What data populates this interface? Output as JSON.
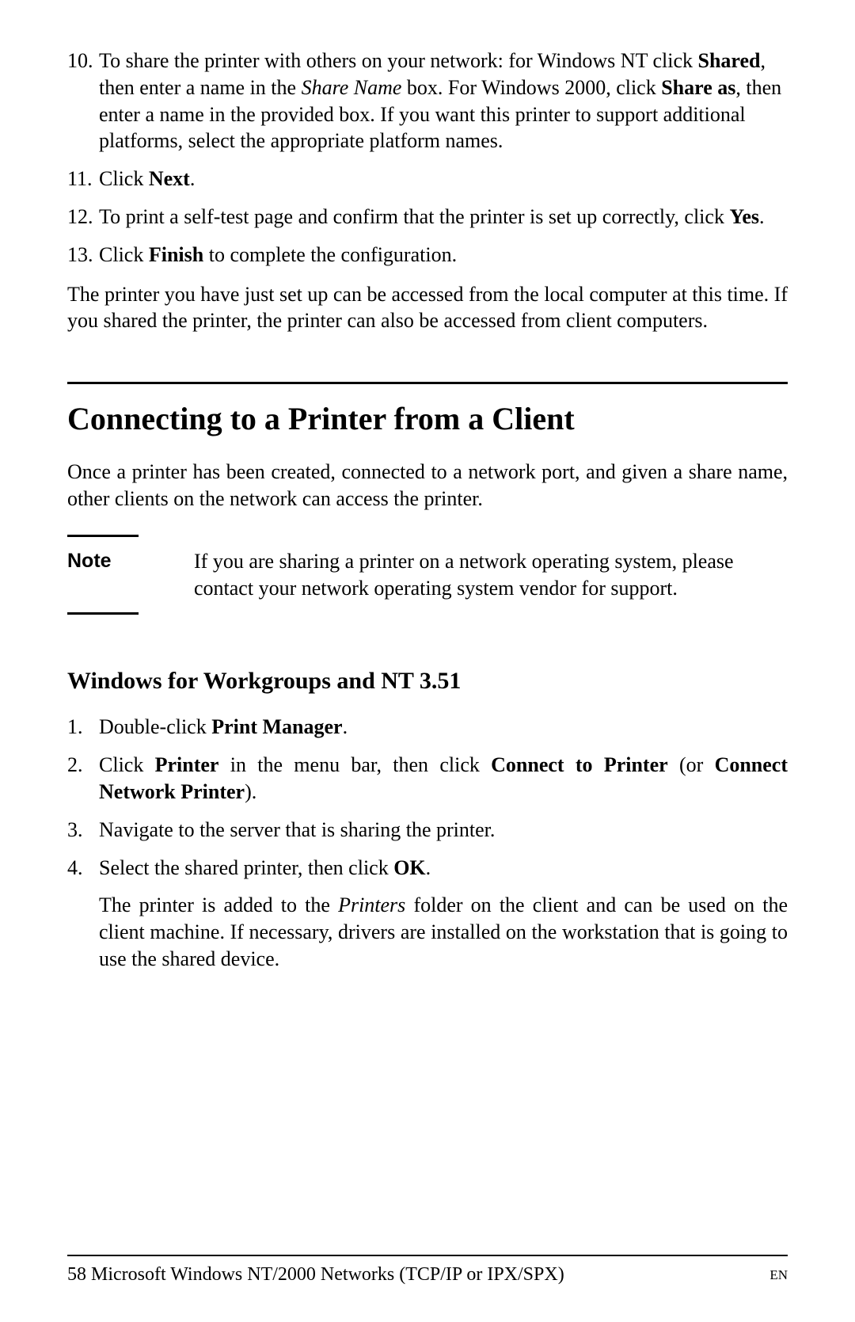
{
  "steps": {
    "s10_a": "To share the printer with others on your network: for Windows NT click ",
    "s10_b": "Shared",
    "s10_c": ", then enter a name in the ",
    "s10_d": "Share Name",
    "s10_e": " box. For Windows 2000, click ",
    "s10_f": "Share as",
    "s10_g": ", then enter a name in the provided box. If you want this printer to support additional platforms, select the appropriate platform names.",
    "s11_a": "Click ",
    "s11_b": "Next",
    "s11_c": ".",
    "s12_a": "To print a self-test page and confirm that the printer is set up correctly, click ",
    "s12_b": "Yes",
    "s12_c": ".",
    "s13_a": "Click ",
    "s13_b": "Finish",
    "s13_c": " to complete the configuration."
  },
  "para1": "The printer you have just set up can be accessed from the local computer at this time. If you shared the printer, the printer can also be accessed from client computers.",
  "heading1": "Connecting to a Printer from a Client",
  "para2": "Once a printer has been created, connected to a network port, and given a share name, other clients on the network can access the printer.",
  "note_label": "Note",
  "note_text": "If you are sharing a printer on a network operating system, please contact your network operating system vendor for support.",
  "heading2": "Windows for Workgroups and NT 3.51",
  "steps2": {
    "s1_a": "Double-click ",
    "s1_b": "Print Manager",
    "s1_c": ".",
    "s2_a": "Click ",
    "s2_b": "Printer",
    "s2_c": " in the menu bar, then click ",
    "s2_d": "Connect to Printer",
    "s2_e": " (or ",
    "s2_f": "Connect Network Printer",
    "s2_g": ").",
    "s3": "Navigate to the server that is sharing the printer.",
    "s4_a": "Select the shared printer, then click ",
    "s4_b": "OK",
    "s4_c": "."
  },
  "after_a": "The printer is added to the ",
  "after_b": "Printers",
  "after_c": " folder on the client and can be used on the client machine. If necessary, drivers are installed on the workstation that is going to use the shared device.",
  "footer": {
    "page": "58",
    "chapter": " Microsoft Windows NT/2000 Networks (TCP/IP or IPX/SPX)",
    "lang": "EN"
  }
}
